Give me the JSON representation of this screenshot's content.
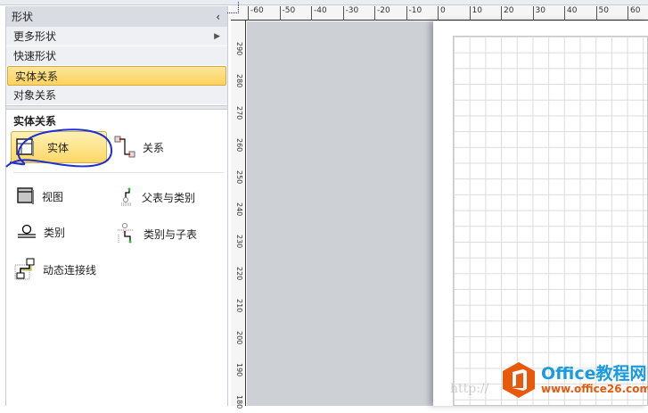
{
  "panel": {
    "title": "形状",
    "collapse_icon": "chevron-left-icon",
    "menu": [
      {
        "label": "更多形状",
        "arrow": true
      },
      {
        "label": "快速形状"
      },
      {
        "label": "实体关系",
        "selected": true
      },
      {
        "label": "对象关系"
      }
    ],
    "section_title": "实体关系",
    "shapes": [
      {
        "label": "实体",
        "icon": "entity-icon"
      },
      {
        "label": "关系",
        "icon": "relationship-icon"
      },
      {
        "label": "视图",
        "icon": "view-icon"
      },
      {
        "label": "父表与类别",
        "icon": "parent-category-icon"
      },
      {
        "label": "类别",
        "icon": "category-icon"
      },
      {
        "label": "类别与子表",
        "icon": "category-child-icon"
      },
      {
        "label": "动态连接线",
        "icon": "dynamic-connector-icon"
      }
    ]
  },
  "ruler": {
    "top": [
      "-60",
      "-50",
      "-40",
      "-30",
      "-20",
      "-10",
      "0",
      "10",
      "20",
      "30",
      "40",
      "50",
      "60"
    ],
    "left": [
      "290",
      "280",
      "270",
      "260",
      "250",
      "240",
      "230",
      "220",
      "210",
      "200",
      "190",
      "180"
    ]
  },
  "watermark": {
    "brand": "Office教程网",
    "url": "www.office26.com",
    "faint": "http://"
  },
  "colors": {
    "selected": "#fbd35c",
    "annotation": "#1a2fd6",
    "brand_orange": "#e8590c",
    "brand_blue": "#1a9be0"
  }
}
